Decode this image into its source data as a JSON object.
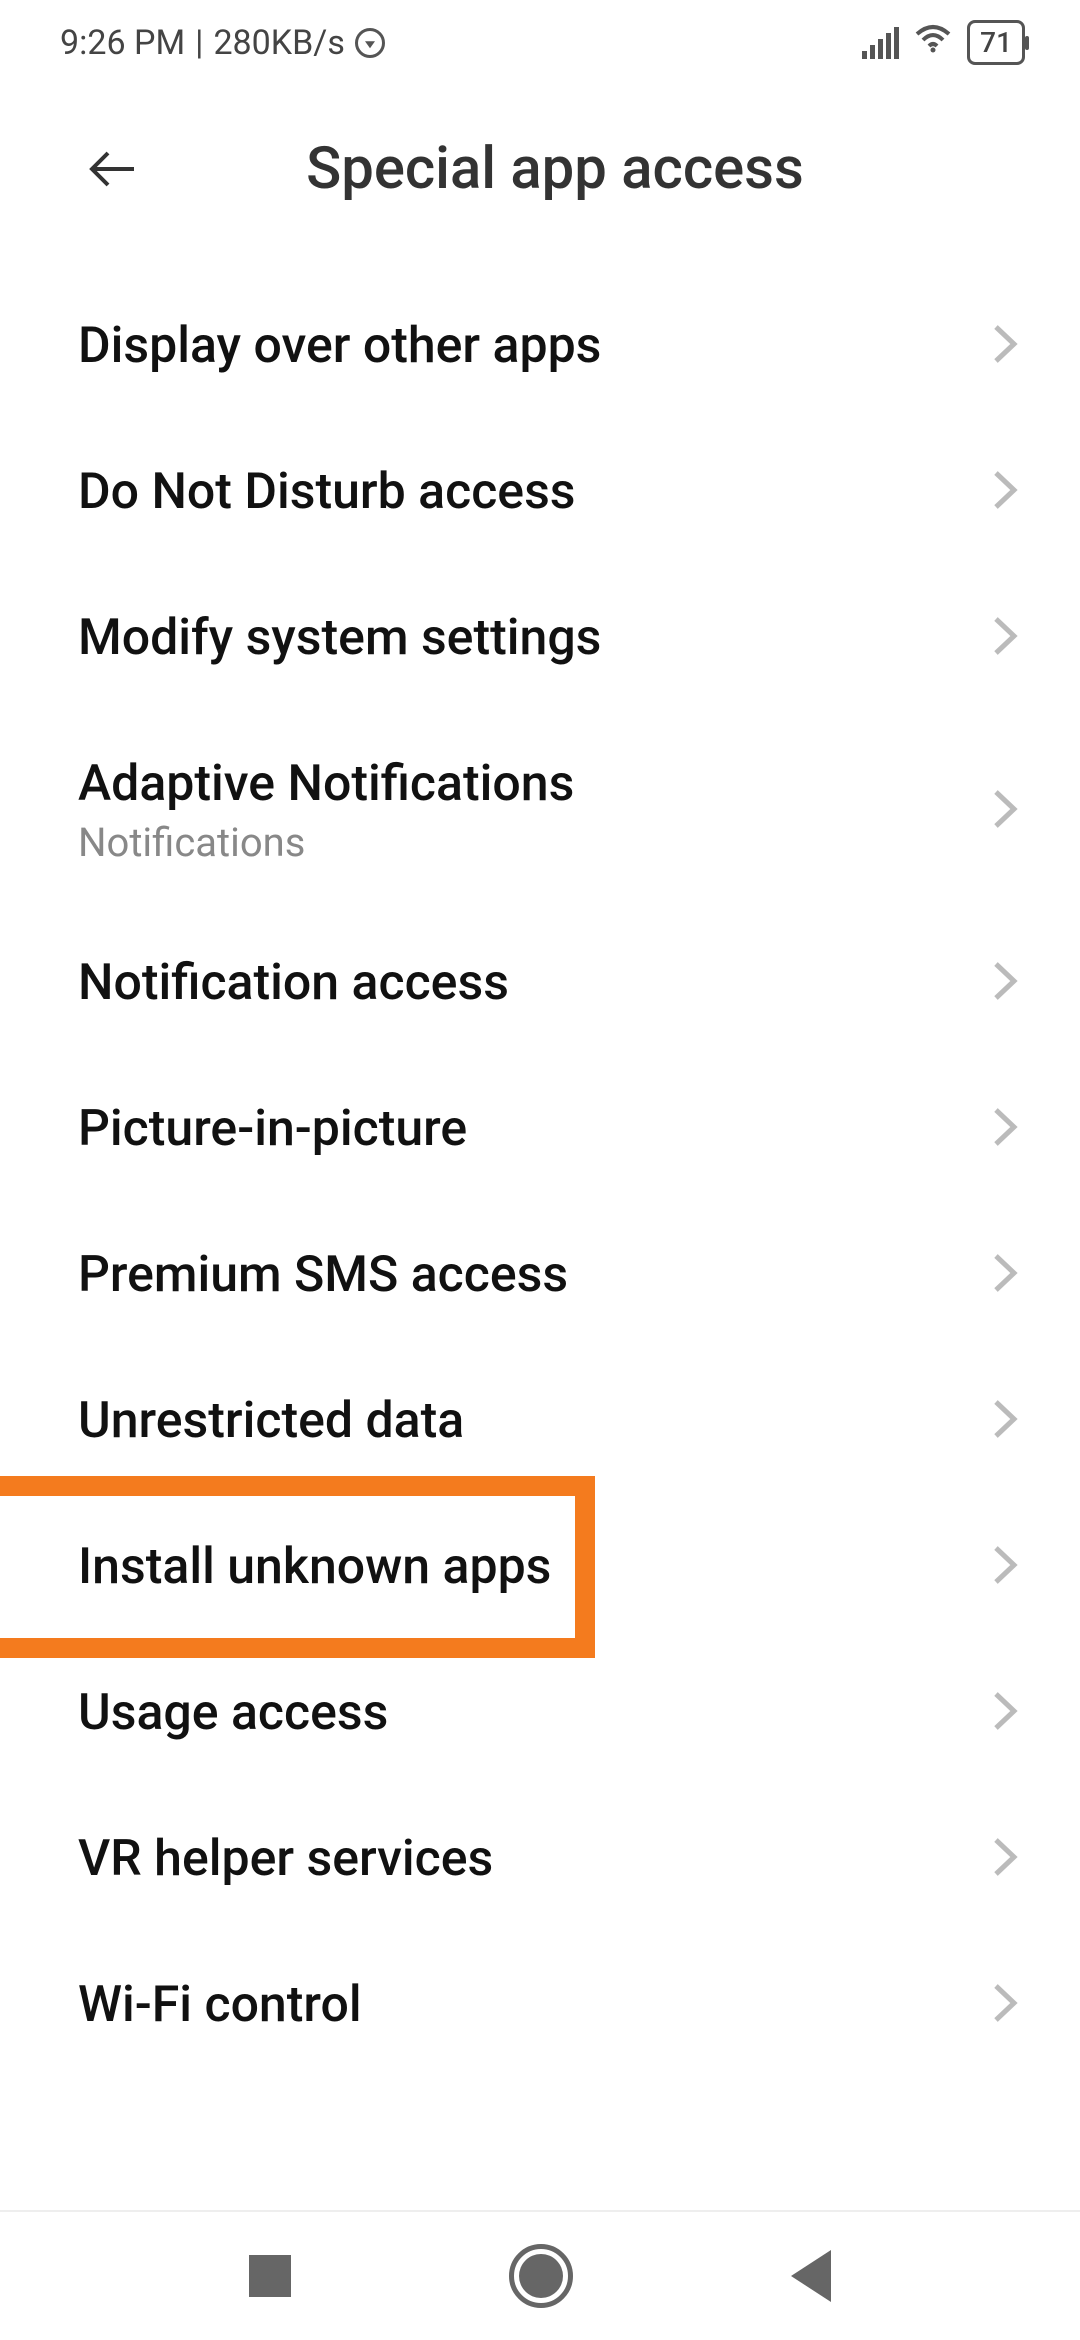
{
  "status": {
    "time": "9:26 PM",
    "separator": " | ",
    "speed": "280KB/s",
    "battery": "71"
  },
  "header": {
    "title": "Special app access"
  },
  "items": [
    {
      "label": "Display over other apps",
      "sub": ""
    },
    {
      "label": "Do Not Disturb access",
      "sub": ""
    },
    {
      "label": "Modify system settings",
      "sub": ""
    },
    {
      "label": "Adaptive Notifications",
      "sub": "Notifications"
    },
    {
      "label": "Notification access",
      "sub": ""
    },
    {
      "label": "Picture-in-picture",
      "sub": ""
    },
    {
      "label": "Premium SMS access",
      "sub": ""
    },
    {
      "label": "Unrestricted data",
      "sub": ""
    },
    {
      "label": "Install unknown apps",
      "sub": ""
    },
    {
      "label": "Usage access",
      "sub": ""
    },
    {
      "label": "VR helper services",
      "sub": ""
    },
    {
      "label": "Wi-Fi control",
      "sub": ""
    }
  ],
  "highlight": {
    "index": 8
  }
}
